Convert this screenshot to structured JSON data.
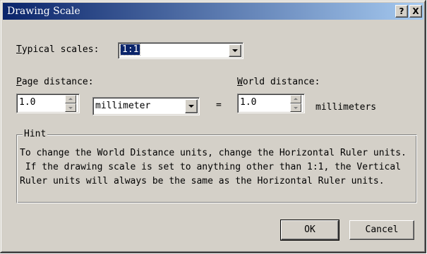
{
  "window": {
    "title": "Drawing Scale",
    "help_glyph": "?",
    "close_glyph": "X"
  },
  "typical_scales": {
    "label_accel": "T",
    "label_rest": "ypical scales:",
    "selected": "1:1"
  },
  "page_distance": {
    "label_accel": "P",
    "label_rest": "age distance:",
    "value": "1.0",
    "unit": "millimeter"
  },
  "equals": "=",
  "world_distance": {
    "label_accel": "W",
    "label_rest": "orld distance:",
    "value": "1.0",
    "unit": "millimeters"
  },
  "hint": {
    "title": "Hint",
    "lines": [
      "To change the World Distance units, change the Horizontal Ruler units.",
      " If the drawing scale is set to anything other than 1:1, the Vertical",
      "Ruler units will always be the same as the Horizontal Ruler units."
    ]
  },
  "buttons": {
    "ok": "OK",
    "cancel": "Cancel"
  },
  "icons": {
    "dropdown": "chevron-down-icon",
    "spin_up": "spin-up-icon",
    "spin_down": "spin-down-icon"
  }
}
